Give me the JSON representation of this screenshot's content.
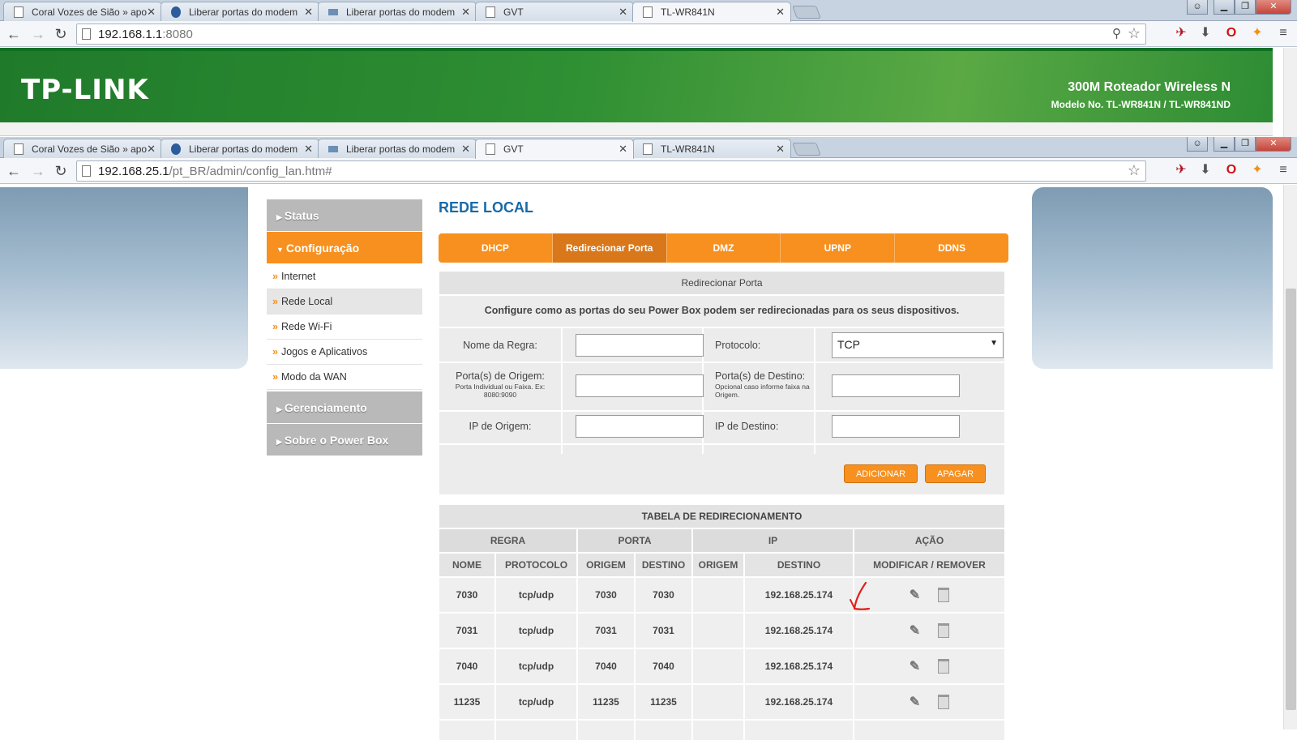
{
  "browser1": {
    "tabs": [
      {
        "label": "Coral Vozes de Sião » apo"
      },
      {
        "label": "Liberar portas do modem"
      },
      {
        "label": "Liberar portas do modem"
      },
      {
        "label": "GVT"
      },
      {
        "label": "TL-WR841N"
      }
    ],
    "url_host": "192.168.1.1",
    "url_rest": ":8080"
  },
  "router": {
    "logo": "TP-LINK",
    "product": "300M Roteador Wireless N",
    "model": "Modelo No. TL-WR841N / TL-WR841ND"
  },
  "browser2": {
    "tabs": [
      {
        "label": "Coral Vozes de Sião » apo"
      },
      {
        "label": "Liberar portas do modem"
      },
      {
        "label": "Liberar portas do modem"
      },
      {
        "label": "GVT"
      },
      {
        "label": "TL-WR841N"
      }
    ],
    "url_host": "192.168.25.1",
    "url_rest": "/pt_BR/admin/config_lan.htm#"
  },
  "menu": {
    "status": "Status",
    "config": "Configuração",
    "items": [
      "Internet",
      "Rede Local",
      "Rede Wi-Fi",
      "Jogos e Aplicativos",
      "Modo da WAN"
    ],
    "manage": "Gerenciamento",
    "about": "Sobre o Power Box"
  },
  "page": {
    "title": "REDE LOCAL",
    "tabs": [
      "DHCP",
      "Redirecionar Porta",
      "DMZ",
      "UPNP",
      "DDNS"
    ],
    "section": "Redirecionar Porta",
    "description": "Configure como as portas do seu Power Box podem ser redirecionadas para os seus dispositivos.",
    "form": {
      "rule_name": "Nome da Regra:",
      "protocol": "Protocolo:",
      "protocol_value": "TCP",
      "src_ports": "Porta(s) de Origem:",
      "src_ports_hint": "Porta Individual ou Faixa. Ex: 8080:9090",
      "dst_ports": "Porta(s) de Destino:",
      "dst_ports_hint": "Opcional caso informe faixa na Origem.",
      "src_ip": "IP de Origem:",
      "dst_ip": "IP de Destino:"
    },
    "add": "ADICIONAR",
    "delete": "APAGAR",
    "table": {
      "title": "TABELA DE REDIRECIONAMENTO",
      "groups": [
        "REGRA",
        "PORTA",
        "IP",
        "AÇÃO"
      ],
      "cols": [
        "NOME",
        "PROTOCOLO",
        "ORIGEM",
        "DESTINO",
        "ORIGEM",
        "DESTINO",
        "MODIFICAR / REMOVER"
      ],
      "rows": [
        {
          "nome": "7030",
          "proto": "tcp/udp",
          "po": "7030",
          "pd": "7030",
          "ipo": "",
          "ipd": "192.168.25.174"
        },
        {
          "nome": "7031",
          "proto": "tcp/udp",
          "po": "7031",
          "pd": "7031",
          "ipo": "",
          "ipd": "192.168.25.174"
        },
        {
          "nome": "7040",
          "proto": "tcp/udp",
          "po": "7040",
          "pd": "7040",
          "ipo": "",
          "ipd": "192.168.25.174"
        },
        {
          "nome": "11235",
          "proto": "tcp/udp",
          "po": "11235",
          "pd": "11235",
          "ipo": "",
          "ipd": "192.168.25.174"
        }
      ]
    }
  }
}
